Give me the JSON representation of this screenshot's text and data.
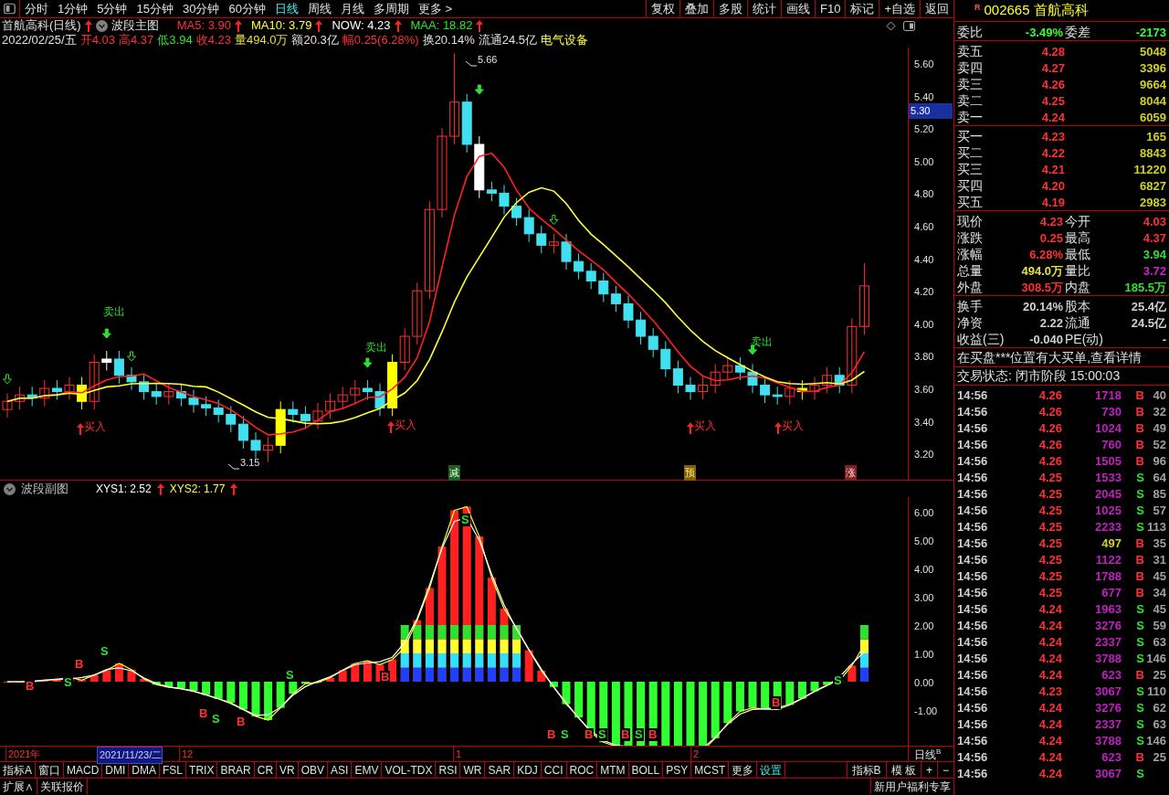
{
  "toolbar": {
    "periods": [
      {
        "label": "分时",
        "selected": false
      },
      {
        "label": "1分钟",
        "selected": false
      },
      {
        "label": "5分钟",
        "selected": false
      },
      {
        "label": "15分钟",
        "selected": false
      },
      {
        "label": "30分钟",
        "selected": false
      },
      {
        "label": "60分钟",
        "selected": false
      },
      {
        "label": "日线",
        "selected": true
      },
      {
        "label": "周线",
        "selected": false
      },
      {
        "label": "月线",
        "selected": false
      },
      {
        "label": "多周期",
        "selected": false
      },
      {
        "label": "更多 >",
        "selected": false
      }
    ],
    "buttons": [
      "复权",
      "叠加",
      "多股",
      "统计",
      "画线",
      "F10",
      "标记",
      "+自选",
      "返回"
    ]
  },
  "main_header": {
    "title": "首航高科(日线)",
    "indicator": "波段主图",
    "values": [
      {
        "text": "MA5: 3.90",
        "color": "#ff3030"
      },
      {
        "text": "MA10: 3.79",
        "color": "#ffff40"
      },
      {
        "text": "NOW: 4.23",
        "color": "#ffffff"
      },
      {
        "text": "MAA: 18.82",
        "color": "#30e030"
      }
    ],
    "quote": [
      {
        "text": "2022/02/25/五",
        "color": "#e0e0e0"
      },
      {
        "text": "开4.03",
        "color": "#ff3030"
      },
      {
        "text": "高4.37",
        "color": "#ff3030"
      },
      {
        "text": "低3.94",
        "color": "#30e030"
      },
      {
        "text": "收4.23",
        "color": "#ff3030"
      },
      {
        "text": "量494.0万",
        "color": "#e0e040"
      },
      {
        "text": "额20.3亿",
        "color": "#e0e0e0"
      },
      {
        "text": "幅0.25(6.28%)",
        "color": "#ff3030"
      },
      {
        "text": "换20.14%",
        "color": "#e0e0e0"
      },
      {
        "text": "流通24.5亿",
        "color": "#e0e0e0"
      },
      {
        "text": "电气设备",
        "color": "#ffff40"
      }
    ]
  },
  "main_chart": {
    "y_labels": [
      "5.60",
      "5.40",
      "5.20",
      "5.00",
      "4.80",
      "4.60",
      "4.40",
      "4.20",
      "4.00",
      "3.80",
      "3.60",
      "3.40",
      "3.20"
    ],
    "price_tag": "5.30",
    "markers": [
      {
        "text": "卖出",
        "kind": "sell"
      },
      {
        "text": "卖出",
        "kind": "sell"
      },
      {
        "text": "卖出",
        "kind": "sell"
      },
      {
        "text": "买入",
        "kind": "buy"
      },
      {
        "text": "买入",
        "kind": "buy"
      },
      {
        "text": "买入",
        "kind": "buy"
      },
      {
        "text": "买入",
        "kind": "buy"
      },
      {
        "text": "5.66",
        "kind": "extreme"
      },
      {
        "text": "3.15",
        "kind": "extreme"
      },
      {
        "text": "减",
        "kind": "tag_green"
      },
      {
        "text": "预",
        "kind": "tag_yellow"
      },
      {
        "text": "涨",
        "kind": "tag_red"
      }
    ]
  },
  "sub_header": {
    "title": "波段副图",
    "values": [
      {
        "text": "XYS1: 2.52",
        "color": "#ffffff"
      },
      {
        "text": "XYS2: 1.77",
        "color": "#ffff40"
      }
    ]
  },
  "sub_chart": {
    "y_labels": [
      "6.00",
      "5.00",
      "4.00",
      "3.00",
      "2.00",
      "1.00",
      "0.00",
      "-1.00"
    ],
    "signals": [
      {
        "text": "B",
        "kind": "buy"
      },
      {
        "text": "S",
        "kind": "sell"
      },
      {
        "text": "B",
        "kind": "buy"
      },
      {
        "text": "S",
        "kind": "sell"
      },
      {
        "text": "B",
        "kind": "buy"
      },
      {
        "text": "S",
        "kind": "sell"
      },
      {
        "text": "B",
        "kind": "buy"
      },
      {
        "text": "S",
        "kind": "sell"
      },
      {
        "text": "B",
        "kind": "buy"
      },
      {
        "text": "S",
        "kind": "sell"
      },
      {
        "text": "B",
        "kind": "buy"
      },
      {
        "text": "S",
        "kind": "sell"
      },
      {
        "text": "B",
        "kind": "buy"
      },
      {
        "text": "S",
        "kind": "sell"
      },
      {
        "text": "B",
        "kind": "buy"
      },
      {
        "text": "S",
        "kind": "sell"
      },
      {
        "text": "B",
        "kind": "buy"
      },
      {
        "text": "B",
        "kind": "buy"
      },
      {
        "text": "S",
        "kind": "sell"
      }
    ]
  },
  "date_axis": {
    "labels": [
      {
        "text": "2021年",
        "selected": false
      },
      {
        "text": "2021/11/23/二",
        "selected": true
      },
      {
        "text": "12",
        "selected": false
      },
      {
        "text": "1",
        "selected": false
      },
      {
        "text": "2",
        "selected": false
      }
    ],
    "period": "日线",
    "period_suffix": "B"
  },
  "indicator_tabs": [
    {
      "label": "指标A",
      "selected": false
    },
    {
      "label": "窗口",
      "selected": false
    },
    {
      "label": "MACD",
      "selected": false
    },
    {
      "label": "DMI",
      "selected": false
    },
    {
      "label": "DMA",
      "selected": false
    },
    {
      "label": "FSL",
      "selected": false
    },
    {
      "label": "TRIX",
      "selected": false
    },
    {
      "label": "BRAR",
      "selected": false
    },
    {
      "label": "CR",
      "selected": false
    },
    {
      "label": "VR",
      "selected": false
    },
    {
      "label": "OBV",
      "selected": false
    },
    {
      "label": "ASI",
      "selected": false
    },
    {
      "label": "EMV",
      "selected": false
    },
    {
      "label": "VOL-TDX",
      "selected": false
    },
    {
      "label": "RSI",
      "selected": false
    },
    {
      "label": "WR",
      "selected": false
    },
    {
      "label": "SAR",
      "selected": false
    },
    {
      "label": "KDJ",
      "selected": false
    },
    {
      "label": "CCI",
      "selected": false
    },
    {
      "label": "ROC",
      "selected": false
    },
    {
      "label": "MTM",
      "selected": false
    },
    {
      "label": "BOLL",
      "selected": false
    },
    {
      "label": "PSY",
      "selected": false
    },
    {
      "label": "MCST",
      "selected": false
    },
    {
      "label": "更多",
      "selected": false
    },
    {
      "label": "设置",
      "selected": true
    }
  ],
  "indicator_tabs_right": [
    "指标B",
    "模 板",
    "+",
    "−"
  ],
  "bottom_bar": {
    "left": [
      "扩展∧",
      "关联报价"
    ],
    "right": "新用户福利专享"
  },
  "quote_panel": {
    "badge": "R",
    "code": "002665 首航高科",
    "ratio": {
      "label": "委比",
      "value": "-3.49%",
      "label2": "委差",
      "value2": "-2173"
    },
    "asks": [
      {
        "label": "卖五",
        "price": "4.28",
        "volume": "5048"
      },
      {
        "label": "卖四",
        "price": "4.27",
        "volume": "3396"
      },
      {
        "label": "卖三",
        "price": "4.26",
        "volume": "9664"
      },
      {
        "label": "卖二",
        "price": "4.25",
        "volume": "8044"
      },
      {
        "label": "卖一",
        "price": "4.24",
        "volume": "6059"
      }
    ],
    "bids": [
      {
        "label": "买一",
        "price": "4.23",
        "volume": "165"
      },
      {
        "label": "买二",
        "price": "4.22",
        "volume": "8843"
      },
      {
        "label": "买三",
        "price": "4.21",
        "volume": "11220"
      },
      {
        "label": "买四",
        "price": "4.20",
        "volume": "6827"
      },
      {
        "label": "买五",
        "price": "4.19",
        "volume": "2983"
      }
    ],
    "stats": [
      {
        "left": {
          "label": "现价",
          "value": "4.23",
          "color": "#ff3030"
        },
        "right": {
          "label": "今开",
          "value": "4.03",
          "color": "#ff3030"
        }
      },
      {
        "left": {
          "label": "涨跌",
          "value": "0.25",
          "color": "#ff3030"
        },
        "right": {
          "label": "最高",
          "value": "4.37",
          "color": "#ff3030"
        }
      },
      {
        "left": {
          "label": "涨幅",
          "value": "6.28%",
          "color": "#ff3030"
        },
        "right": {
          "label": "最低",
          "value": "3.94",
          "color": "#30e030"
        }
      },
      {
        "left": {
          "label": "总量",
          "value": "494.0万",
          "color": "#e0e040"
        },
        "right": {
          "label": "量比",
          "value": "3.72",
          "color": "#d020d0"
        }
      },
      {
        "left": {
          "label": "外盘",
          "value": "308.5万",
          "color": "#ff3030"
        },
        "right": {
          "label": "内盘",
          "value": "185.5万",
          "color": "#30e030"
        }
      }
    ],
    "fundamentals": [
      {
        "label": "换手",
        "value": "20.14%",
        "label2": "股本",
        "value2": "25.4亿"
      },
      {
        "label": "净资",
        "value": "2.22",
        "label2": "流通",
        "value2": "24.5亿"
      },
      {
        "label": "收益(三)",
        "value": "-0.040",
        "label2": "PE(动)",
        "value2": "-"
      }
    ],
    "notice": "在买盘***位置有大买单,查看详情",
    "status": "交易状态: 闭市阶段 15:00:03",
    "trades": [
      {
        "time": "14:56",
        "price": "4.26",
        "volume": "1718",
        "side": "B",
        "kind": "buy",
        "count": "40",
        "big": false
      },
      {
        "time": "14:56",
        "price": "4.26",
        "volume": "730",
        "side": "B",
        "kind": "buy",
        "count": "32",
        "big": false
      },
      {
        "time": "14:56",
        "price": "4.26",
        "volume": "1024",
        "side": "B",
        "kind": "buy",
        "count": "49",
        "big": false
      },
      {
        "time": "14:56",
        "price": "4.26",
        "volume": "760",
        "side": "B",
        "kind": "buy",
        "count": "52",
        "big": false
      },
      {
        "time": "14:56",
        "price": "4.26",
        "volume": "1505",
        "side": "B",
        "kind": "buy",
        "count": "96",
        "big": false
      },
      {
        "time": "14:56",
        "price": "4.25",
        "volume": "1533",
        "side": "S",
        "kind": "sell",
        "count": "64",
        "big": false
      },
      {
        "time": "14:56",
        "price": "4.25",
        "volume": "2045",
        "side": "S",
        "kind": "sell",
        "count": "85",
        "big": false
      },
      {
        "time": "14:56",
        "price": "4.25",
        "volume": "1025",
        "side": "S",
        "kind": "sell",
        "count": "57",
        "big": false
      },
      {
        "time": "14:56",
        "price": "4.25",
        "volume": "2233",
        "side": "S",
        "kind": "sell",
        "count": "113",
        "big": false
      },
      {
        "time": "14:56",
        "price": "4.25",
        "volume": "497",
        "side": "B",
        "kind": "buy",
        "count": "35",
        "big": true
      },
      {
        "time": "14:56",
        "price": "4.25",
        "volume": "1122",
        "side": "B",
        "kind": "buy",
        "count": "31",
        "big": false
      },
      {
        "time": "14:56",
        "price": "4.25",
        "volume": "1788",
        "side": "B",
        "kind": "buy",
        "count": "45",
        "big": false
      },
      {
        "time": "14:56",
        "price": "4.25",
        "volume": "677",
        "side": "B",
        "kind": "buy",
        "count": "34",
        "big": false
      },
      {
        "time": "14:56",
        "price": "4.24",
        "volume": "1963",
        "side": "S",
        "kind": "sell",
        "count": "45",
        "big": false
      },
      {
        "time": "14:56",
        "price": "4.24",
        "volume": "3276",
        "side": "S",
        "kind": "sell",
        "count": "59",
        "big": false
      },
      {
        "time": "14:56",
        "price": "4.24",
        "volume": "2337",
        "side": "S",
        "kind": "sell",
        "count": "63",
        "big": false
      },
      {
        "time": "14:56",
        "price": "4.24",
        "volume": "3788",
        "side": "S",
        "kind": "sell",
        "count": "146",
        "big": false
      },
      {
        "time": "14:56",
        "price": "4.24",
        "volume": "623",
        "side": "B",
        "kind": "buy",
        "count": "25",
        "big": false
      },
      {
        "time": "14:56",
        "price": "4.23",
        "volume": "3067",
        "side": "S",
        "kind": "sell",
        "count": "110",
        "big": false
      },
      {
        "time": "14:56",
        "price": "4.24",
        "volume": "3276",
        "side": "S",
        "kind": "sell",
        "count": "62",
        "big": false
      },
      {
        "time": "14:56",
        "price": "4.24",
        "volume": "2337",
        "side": "S",
        "kind": "sell",
        "count": "63",
        "big": false
      },
      {
        "time": "14:56",
        "price": "4.24",
        "volume": "3788",
        "side": "S",
        "kind": "sell",
        "count": "146",
        "big": false
      },
      {
        "time": "14:56",
        "price": "4.24",
        "volume": "623",
        "side": "B",
        "kind": "buy",
        "count": "25",
        "big": false
      },
      {
        "time": "14:56",
        "price": "4.24",
        "volume": "3067",
        "side": "S",
        "kind": "sell",
        "big": false
      }
    ]
  }
}
